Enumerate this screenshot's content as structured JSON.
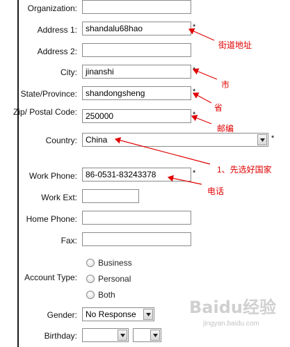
{
  "form": {
    "organization": {
      "label": "Organization:",
      "value": ""
    },
    "address1": {
      "label": "Address 1:",
      "value": "shandalu68hao",
      "required": "*"
    },
    "address2": {
      "label": "Address 2:",
      "value": ""
    },
    "city": {
      "label": "City:",
      "value": "jinanshi",
      "required": "*"
    },
    "state": {
      "label": "State/Province:",
      "value": "shandongsheng",
      "required": "*"
    },
    "zip": {
      "label": "Zip/ Postal Code:",
      "value": "250000",
      "required": "*"
    },
    "country": {
      "label": "Country:",
      "value": "China",
      "required": "*"
    },
    "work_phone": {
      "label": "Work Phone:",
      "value": "86-0531-83243378",
      "required": "*"
    },
    "work_ext": {
      "label": "Work Ext:",
      "value": ""
    },
    "home_phone": {
      "label": "Home Phone:",
      "value": ""
    },
    "fax": {
      "label": "Fax:",
      "value": ""
    },
    "account_type": {
      "label": "Account Type:",
      "options": [
        "Business",
        "Personal",
        "Both"
      ]
    },
    "gender": {
      "label": "Gender:",
      "value": "No Response"
    },
    "birthday": {
      "label": "Birthday:",
      "month": "",
      "day": ""
    }
  },
  "annotations": {
    "address": "街道地址",
    "city": "市",
    "state": "省",
    "zip": "邮编",
    "country": "1、先选好国家",
    "phone": "电话"
  },
  "watermark": {
    "text": "Baidu经验",
    "sub": "jingyan.baidu.com"
  },
  "colors": {
    "annotation": "#e00000",
    "border": "#8a8a8a",
    "rule": "#1a1a1a"
  }
}
